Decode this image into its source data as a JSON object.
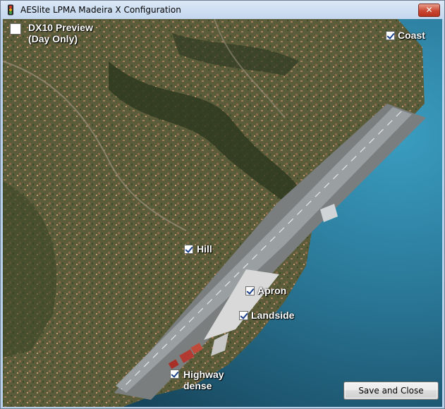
{
  "window": {
    "title": "AESlite LPMA Madeira X Configuration",
    "close_glyph": "✕",
    "app_icon": "traffic-light-icon"
  },
  "options": {
    "dx10_line1": "DX10 Preview",
    "dx10_line2": "(Day Only)",
    "dx10_checked": false,
    "coast": "Coast",
    "coast_checked": true,
    "hill": "Hill",
    "hill_checked": true,
    "apron": "Apron",
    "apron_checked": true,
    "landside": "Landside",
    "landside_checked": true,
    "highway_line1": "Highway",
    "highway_line2": "dense",
    "highway_checked": true
  },
  "actions": {
    "save_close": "Save and Close"
  },
  "colors": {
    "titlebar": "#c4d7ee",
    "close_button": "#c94732",
    "sea_deep": "#1f4f66",
    "sea_shallow": "#2f86a8",
    "land": "#5e5f3a",
    "runway": "#8f9496",
    "apron": "#d8d8d8",
    "label_text": "#ffffff"
  }
}
